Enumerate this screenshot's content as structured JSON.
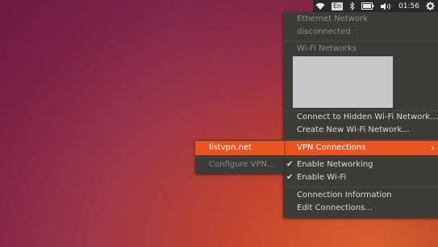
{
  "topbar": {
    "wifi_icon": "wifi-icon",
    "language": "En",
    "bluetooth_icon": "bluetooth-icon",
    "battery_icon": "battery-icon",
    "volume_icon": "volume-icon",
    "clock": "01:56",
    "settings_icon": "gear-icon"
  },
  "network_menu": {
    "ethernet_header": "Ethernet Network",
    "ethernet_status": "disconnected",
    "wifi_header": "Wi-Fi Networks",
    "connect_hidden": "Connect to Hidden Wi-Fi Network...",
    "create_new": "Create New Wi-Fi Network...",
    "vpn_connections": "VPN Connections",
    "enable_networking": "Enable Networking",
    "enable_wifi": "Enable Wi-Fi",
    "connection_info": "Connection Information",
    "edit_connections": "Edit Connections...",
    "enable_networking_checked": true,
    "enable_wifi_checked": true
  },
  "vpn_submenu": {
    "item": "listvpn.net",
    "configure": "Configure VPN..."
  },
  "colors": {
    "accent": "#e95420",
    "menu_bg": "#3c3b37",
    "panel_bg": "#2a2a28"
  }
}
